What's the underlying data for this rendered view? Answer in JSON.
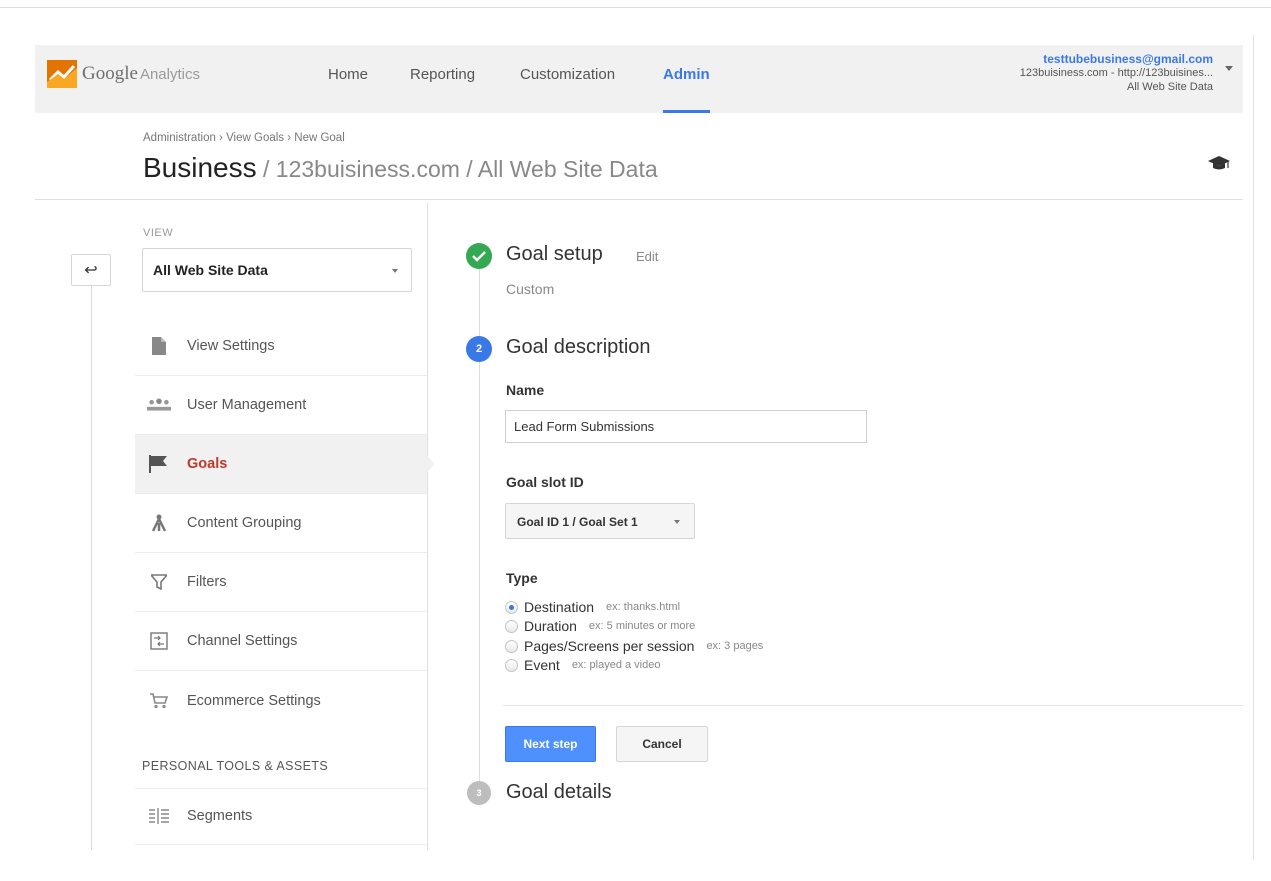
{
  "header": {
    "logo_text": "Google",
    "logo_sub": "Analytics",
    "nav": [
      "Home",
      "Reporting",
      "Customization",
      "Admin"
    ],
    "active_nav": "Admin",
    "account": {
      "email": "testtubebusiness@gmail.com",
      "property": "123buisiness.com - http://123buisines...",
      "view": "All Web Site Data"
    }
  },
  "breadcrumb": "Administration › View Goals › New Goal",
  "title": {
    "main": "Business",
    "path": " / 123buisiness.com / All Web Site Data"
  },
  "sidebar": {
    "view_label": "VIEW",
    "view_selected": "All Web Site Data",
    "items": [
      {
        "label": "View Settings",
        "icon": "document-icon"
      },
      {
        "label": "User Management",
        "icon": "users-icon"
      },
      {
        "label": "Goals",
        "icon": "flag-icon",
        "active": true
      },
      {
        "label": "Content Grouping",
        "icon": "content-grouping-icon"
      },
      {
        "label": "Filters",
        "icon": "filter-icon"
      },
      {
        "label": "Channel Settings",
        "icon": "channel-settings-icon"
      },
      {
        "label": "Ecommerce Settings",
        "icon": "cart-icon"
      }
    ],
    "section_label": "PERSONAL TOOLS & ASSETS",
    "section_items": [
      {
        "label": "Segments",
        "icon": "segments-icon"
      }
    ]
  },
  "steps": {
    "setup": {
      "title": "Goal setup",
      "edit": "Edit",
      "value": "Custom"
    },
    "description": {
      "number": "2",
      "title": "Goal description",
      "name_label": "Name",
      "name_value": "Lead Form Submissions",
      "slot_label": "Goal slot ID",
      "slot_value": "Goal ID 1 / Goal Set 1",
      "type_label": "Type",
      "types": [
        {
          "label": "Destination",
          "hint": "ex: thanks.html",
          "checked": true
        },
        {
          "label": "Duration",
          "hint": "ex: 5 minutes or more",
          "checked": false
        },
        {
          "label": "Pages/Screens per session",
          "hint": "ex: 3 pages",
          "checked": false
        },
        {
          "label": "Event",
          "hint": "ex: played a video",
          "checked": false
        }
      ],
      "next_label": "Next step",
      "cancel_label": "Cancel"
    },
    "details": {
      "number": "3",
      "title": "Goal details"
    }
  },
  "colors": {
    "accent": "#3b78e7",
    "button_primary": "#4d90fe",
    "step_complete": "#34a853",
    "step_active": "#3b78e7",
    "step_pending": "#bdbdbd",
    "active_sidebar_text": "#c0392b"
  }
}
